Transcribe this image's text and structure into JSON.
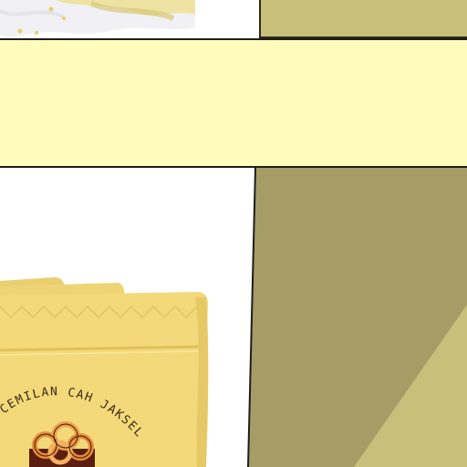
{
  "product": {
    "brand_text": "CEMILAN CAH JAKSEL"
  },
  "colors": {
    "band": "#fefcbb",
    "olive_dark": "#a69c66",
    "olive_light": "#c8bf7c",
    "bag": "#f3d97a",
    "bag_shadow": "#e6c867"
  },
  "icons": {
    "snack_logo": "rings-logo-icon"
  }
}
